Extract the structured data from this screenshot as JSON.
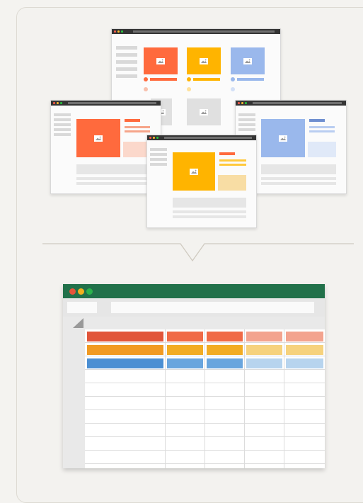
{
  "colors": {
    "background": "#f4f3f0",
    "sheet_titlebar": "#21714a",
    "dot_red": "#e5543a",
    "dot_yellow": "#f2b01e",
    "dot_green": "#2bb24c",
    "orange_dark": "#e1553a",
    "orange_mid": "#f06a46",
    "orange_light": "#f3a38e",
    "amber_dark": "#f19a22",
    "amber_mid": "#f2ac23",
    "amber_light": "#f6d27d",
    "blue_dark": "#4b8fd3",
    "blue_mid": "#68a5de",
    "blue_light": "#b7d4ee",
    "mockup_orange": "#ff6a3d",
    "mockup_yellow": "#ffb400",
    "mockup_blue": "#9ab8ec"
  },
  "icons": {
    "image_placeholder": "image-icon",
    "connector": "chevron-down-pointer"
  },
  "spreadsheet": {
    "row_color_groups": [
      "orange",
      "amber",
      "blue"
    ],
    "empty_rows": 8
  }
}
